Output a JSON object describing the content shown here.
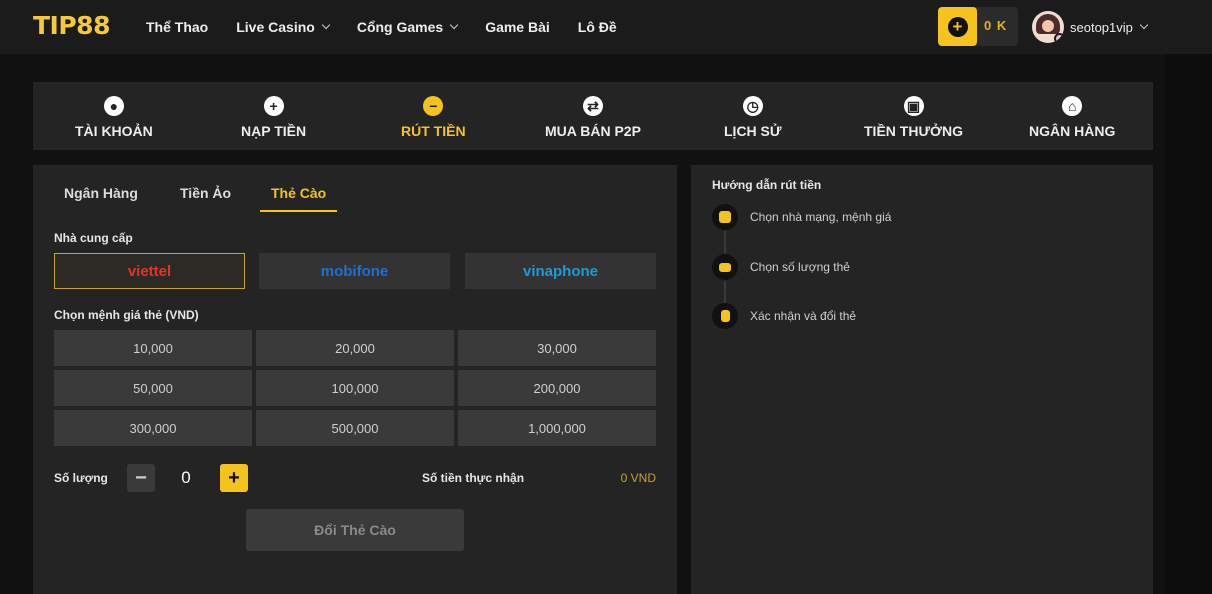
{
  "header": {
    "logo": "TIP88",
    "nav": [
      {
        "label": "Thể Thao",
        "dropdown": false
      },
      {
        "label": "Live Casino",
        "dropdown": true
      },
      {
        "label": "Cổng Games",
        "dropdown": true
      },
      {
        "label": "Game Bài",
        "dropdown": false
      },
      {
        "label": "Lô Đề",
        "dropdown": false
      }
    ],
    "wallet": {
      "add_symbol": "+",
      "balance": "0 K"
    },
    "user": {
      "username": "seotop1vip"
    }
  },
  "tabs": [
    {
      "label": "TÀI KHOẢN",
      "icon": "user-circle-icon",
      "glyph": "●",
      "active": false
    },
    {
      "label": "NẠP TIỀN",
      "icon": "plus-circle-icon",
      "glyph": "+",
      "active": false
    },
    {
      "label": "RÚT TIỀN",
      "icon": "minus-circle-icon",
      "glyph": "−",
      "active": true
    },
    {
      "label": "MUA BÁN P2P",
      "icon": "swap-circle-icon",
      "glyph": "⇄",
      "active": false
    },
    {
      "label": "LỊCH SỬ",
      "icon": "clock-icon",
      "glyph": "◷",
      "active": false
    },
    {
      "label": "TIỀN THƯỞNG",
      "icon": "gift-icon",
      "glyph": "▣",
      "active": false
    },
    {
      "label": "NGÂN HÀNG",
      "icon": "bank-icon",
      "glyph": "⌂",
      "active": false
    }
  ],
  "withdraw": {
    "subtabs": [
      {
        "label": "Ngân Hàng",
        "active": false
      },
      {
        "label": "Tiền Ảo",
        "active": false
      },
      {
        "label": "Thẻ Cào",
        "active": true
      }
    ],
    "provider_label": "Nhà cung cấp",
    "providers": [
      {
        "name": "viettel",
        "color": "#e5322d",
        "active": true
      },
      {
        "name": "mobifone",
        "color": "#1f6fd1",
        "active": false
      },
      {
        "name": "vinaphone",
        "color": "#1e9ad6",
        "active": false
      }
    ],
    "denomination_label": "Chọn mệnh giá thẻ (VND)",
    "denominations": [
      "10,000",
      "20,000",
      "30,000",
      "50,000",
      "100,000",
      "200,000",
      "300,000",
      "500,000",
      "1,000,000"
    ],
    "quantity_label": "Số lượng",
    "quantity_value": "0",
    "minus_symbol": "−",
    "plus_symbol": "+",
    "received_label": "Số tiền thực nhận",
    "received_value": "0 VND",
    "submit_label": "Đổi Thẻ Cào"
  },
  "guide": {
    "title": "Hướng dẫn rút tiền",
    "steps": [
      {
        "text": "Chọn nhà mạng, mệnh giá",
        "icon": "check-badge-icon"
      },
      {
        "text": "Chọn số lượng thẻ",
        "icon": "card-icon"
      },
      {
        "text": "Xác nhận và đổi thẻ",
        "icon": "phone-card-icon"
      }
    ]
  },
  "colors": {
    "accent": "#f5c31d",
    "panel": "#242424",
    "background": "#111111"
  }
}
